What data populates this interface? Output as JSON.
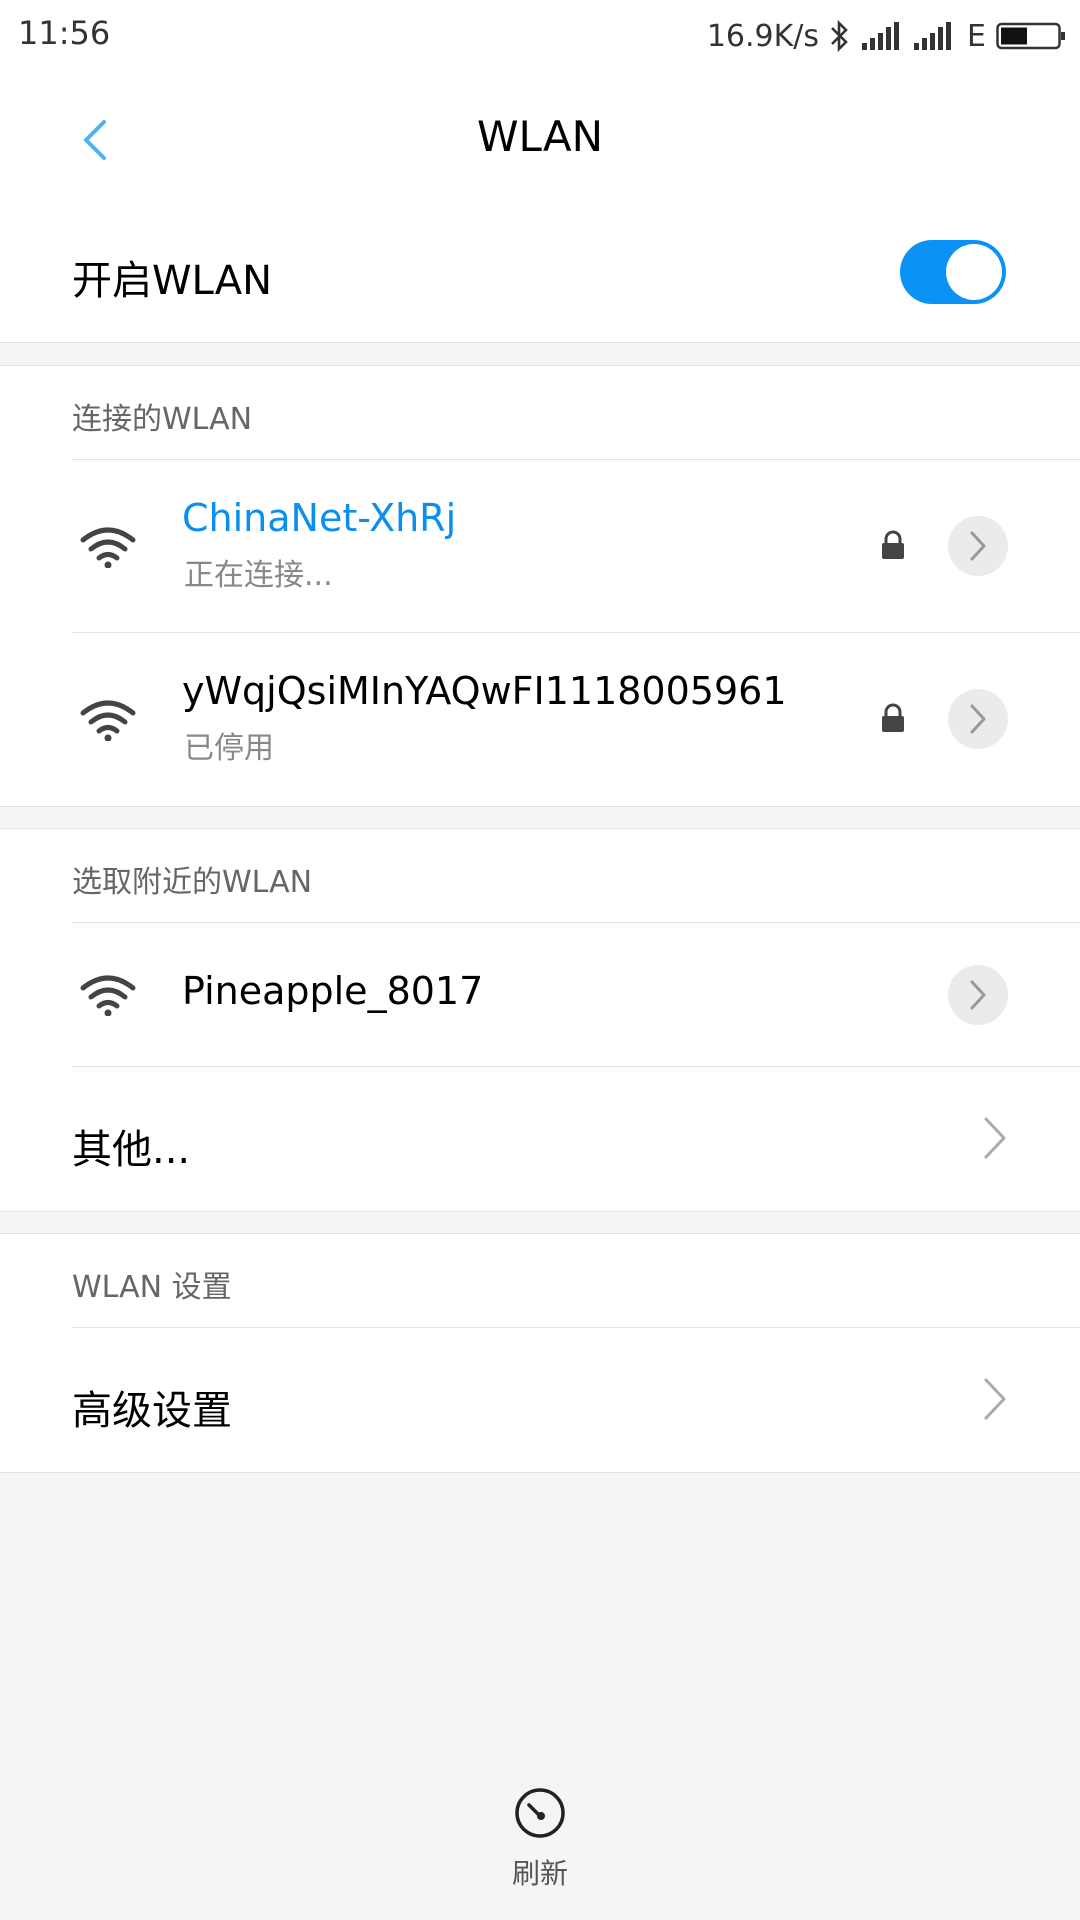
{
  "status_bar": {
    "time": "11:56",
    "speed": "16.9K/s",
    "network_type": "E",
    "icons": [
      "bluetooth-icon",
      "signal-icon",
      "signal-icon",
      "battery-icon"
    ]
  },
  "header": {
    "title": "WLAN"
  },
  "wlan_toggle": {
    "label": "开启WLAN",
    "enabled": true
  },
  "connected_section": {
    "header": "连接的WLAN",
    "networks": [
      {
        "ssid": "ChinaNet-XhRj",
        "status": "正在连接...",
        "secured": true
      },
      {
        "ssid": "yWqjQsiMInYAQwFI1118005961",
        "status": "已停用",
        "secured": true
      }
    ]
  },
  "nearby_section": {
    "header": "选取附近的WLAN",
    "networks": [
      {
        "ssid": "Pineapple_8017",
        "secured": false
      }
    ],
    "other_label": "其他..."
  },
  "settings_section": {
    "header": "WLAN 设置",
    "advanced_label": "高级设置"
  },
  "refresh": {
    "label": "刷新"
  },
  "colors": {
    "accent": "#0a93f5",
    "connecting_text": "#0a8ff0",
    "back_arrow": "#4db3f7",
    "background": "#f5f5f5"
  }
}
